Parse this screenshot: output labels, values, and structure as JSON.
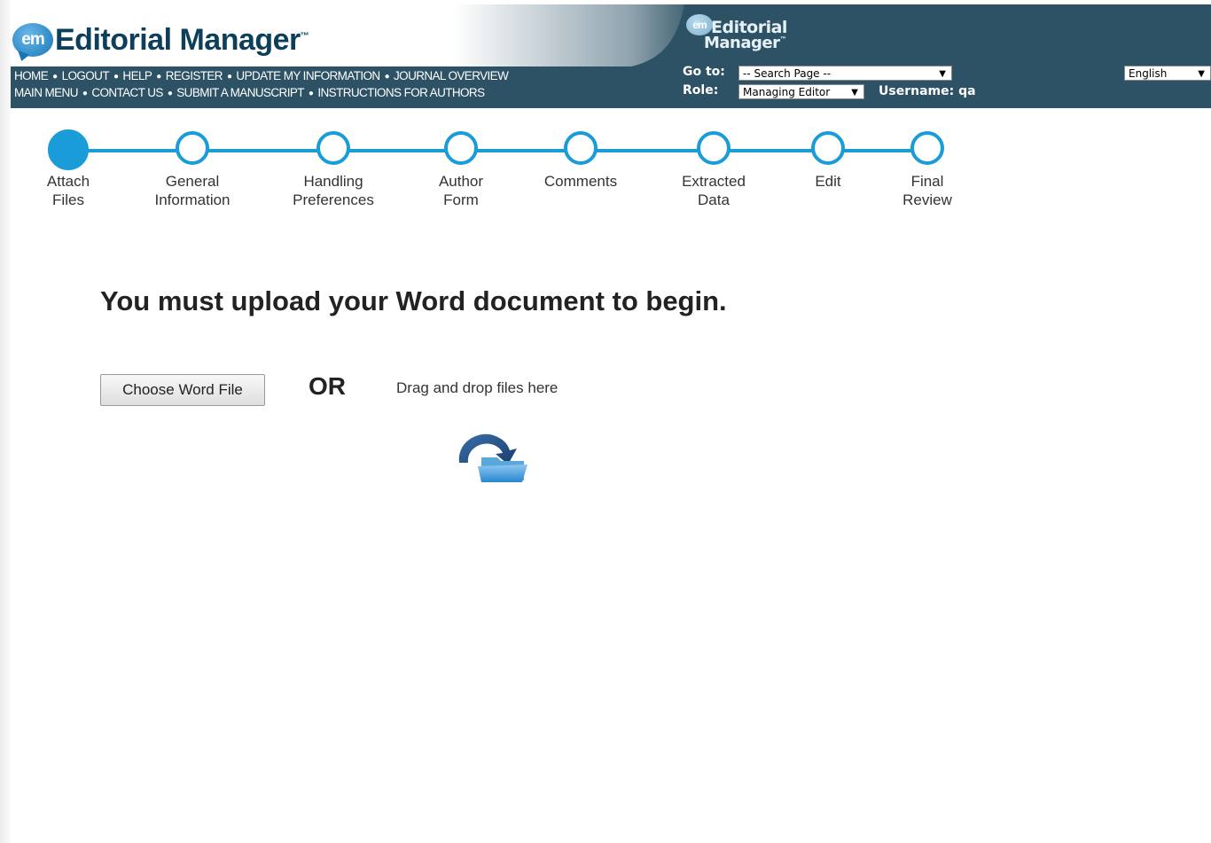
{
  "header": {
    "logo_em": "em",
    "logo_text": "Editorial Manager",
    "logo_tm": "™",
    "small_logo_line1": "Editorial",
    "small_logo_line2": "Manager",
    "nav_row1": [
      "HOME",
      "LOGOUT",
      "HELP",
      "REGISTER",
      "UPDATE MY INFORMATION",
      "JOURNAL OVERVIEW"
    ],
    "nav_row2": [
      "MAIN MENU",
      "CONTACT US",
      "SUBMIT A MANUSCRIPT",
      "INSTRUCTIONS FOR AUTHORS"
    ],
    "goto_label": "Go to:",
    "goto_value": "-- Search Page --",
    "role_label": "Role:",
    "role_value": "Managing Editor",
    "username_label": "Username: qa",
    "language_value": "English",
    "caret": "▼"
  },
  "stepper": {
    "steps": [
      {
        "label1": "Attach",
        "label2": "Files",
        "active": true
      },
      {
        "label1": "General",
        "label2": "Information",
        "active": false
      },
      {
        "label1": "Handling",
        "label2": "Preferences",
        "active": false
      },
      {
        "label1": "Author",
        "label2": "Form",
        "active": false
      },
      {
        "label1": "Comments",
        "label2": "",
        "active": false
      },
      {
        "label1": "Extracted",
        "label2": "Data",
        "active": false
      },
      {
        "label1": "Edit",
        "label2": "",
        "active": false
      },
      {
        "label1": "Final",
        "label2": "Review",
        "active": false
      }
    ]
  },
  "main": {
    "heading": "You must upload your Word document to begin.",
    "choose_button": "Choose Word File",
    "or_text": "OR",
    "drag_drop_text": "Drag and drop files here",
    "drop_icon": "folder-upload-icon"
  },
  "colors": {
    "header_bg": "#2e5265",
    "step_accent": "#1a9cd8"
  }
}
